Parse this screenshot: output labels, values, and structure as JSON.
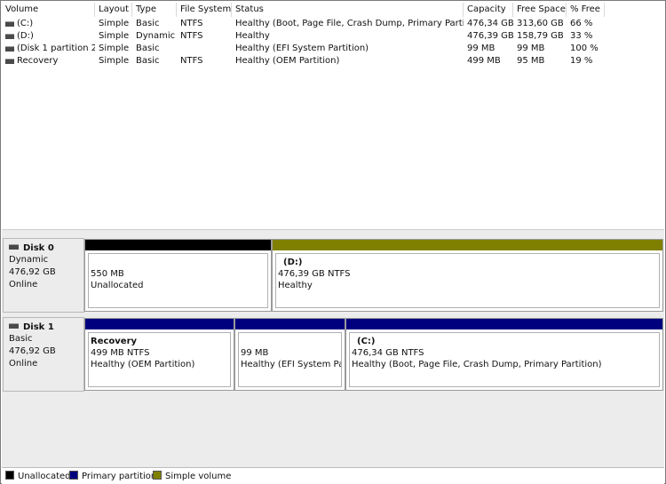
{
  "volume_list": {
    "columns": [
      "Volume",
      "Layout",
      "Type",
      "File System",
      "Status",
      "Capacity",
      "Free Space",
      "% Free"
    ],
    "rows": [
      {
        "volume": "(C:)",
        "layout": "Simple",
        "type": "Basic",
        "fs": "NTFS",
        "status": "Healthy (Boot, Page File, Crash Dump, Primary Partition)",
        "capacity": "476,34 GB",
        "free": "313,60 GB",
        "pct": "66 %"
      },
      {
        "volume": "(D:)",
        "layout": "Simple",
        "type": "Dynamic",
        "fs": "NTFS",
        "status": "Healthy",
        "capacity": "476,39 GB",
        "free": "158,79 GB",
        "pct": "33 %"
      },
      {
        "volume": "(Disk 1 partition 2)",
        "layout": "Simple",
        "type": "Basic",
        "fs": "",
        "status": "Healthy (EFI System Partition)",
        "capacity": "99 MB",
        "free": "99 MB",
        "pct": "100 %"
      },
      {
        "volume": "Recovery",
        "layout": "Simple",
        "type": "Basic",
        "fs": "NTFS",
        "status": "Healthy (OEM Partition)",
        "capacity": "499 MB",
        "free": "95 MB",
        "pct": "19 %"
      }
    ]
  },
  "disks": [
    {
      "name": "Disk 0",
      "type": "Dynamic",
      "size": "476,92 GB",
      "state": "Online",
      "partitions": [
        {
          "title": "",
          "size": "550 MB",
          "status": "Unallocated",
          "bar_color": "#000000"
        },
        {
          "title": "(D:)",
          "size": "476,39 GB NTFS",
          "status": "Healthy",
          "bar_color": "#808000"
        }
      ]
    },
    {
      "name": "Disk 1",
      "type": "Basic",
      "size": "476,92 GB",
      "state": "Online",
      "partitions": [
        {
          "title": "Recovery",
          "size": "499 MB NTFS",
          "status": "Healthy (OEM Partition)",
          "bar_color": "#00007f"
        },
        {
          "title": "",
          "size": "99 MB",
          "status": "Healthy (EFI System Parti",
          "bar_color": "#00007f"
        },
        {
          "title": "(C:)",
          "size": "476,34 GB NTFS",
          "status": "Healthy (Boot, Page File, Crash Dump, Primary Partition)",
          "bar_color": "#00007f"
        }
      ]
    }
  ],
  "legend": [
    {
      "label": "Unallocated",
      "color": "#000000"
    },
    {
      "label": "Primary partition",
      "color": "#00007f"
    },
    {
      "label": "Simple volume",
      "color": "#808000"
    }
  ]
}
